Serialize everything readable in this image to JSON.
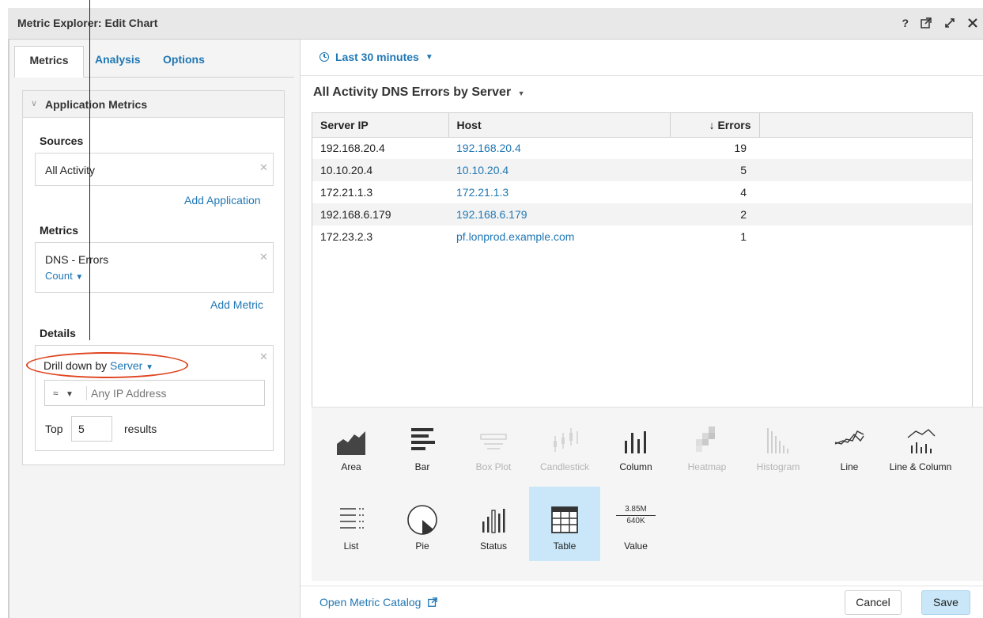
{
  "window": {
    "title": "Metric Explorer: Edit Chart",
    "help": "?",
    "icons": [
      "external-window-icon",
      "expand-icon",
      "close-icon"
    ]
  },
  "tabs": [
    {
      "label": "Metrics",
      "active": true
    },
    {
      "label": "Analysis",
      "active": false
    },
    {
      "label": "Options",
      "active": false
    }
  ],
  "panel": {
    "header": "Application Metrics",
    "sources": {
      "title": "Sources",
      "value": "All Activity",
      "add_link": "Add Application"
    },
    "metrics": {
      "title": "Metrics",
      "value": "DNS - Errors",
      "aggregate": "Count",
      "add_link": "Add Metric"
    },
    "details": {
      "title": "Details",
      "drill_prefix": "Drill down by",
      "drill_value": "Server",
      "operator": "≈",
      "filter_placeholder": "Any IP Address",
      "top_label": "Top",
      "top_value": "5",
      "results_label": "results"
    }
  },
  "time_range": "Last 30 minutes",
  "chart_title": "All Activity DNS Errors by Server",
  "table": {
    "columns": [
      "Server IP",
      "Host",
      "↓ Errors"
    ],
    "rows": [
      {
        "server_ip": "192.168.20.4",
        "host": "192.168.20.4",
        "errors": "19"
      },
      {
        "server_ip": "10.10.20.4",
        "host": "10.10.20.4",
        "errors": "5"
      },
      {
        "server_ip": "172.21.1.3",
        "host": "172.21.1.3",
        "errors": "4"
      },
      {
        "server_ip": "192.168.6.179",
        "host": "192.168.6.179",
        "errors": "2"
      },
      {
        "server_ip": "172.23.2.3",
        "host": "pf.lonprod.example.com",
        "errors": "1"
      }
    ]
  },
  "chart_types": [
    {
      "label": "Area",
      "icon": "area-chart-icon",
      "enabled": true
    },
    {
      "label": "Bar",
      "icon": "bar-chart-icon",
      "enabled": true
    },
    {
      "label": "Box Plot",
      "icon": "box-plot-icon",
      "enabled": false
    },
    {
      "label": "Candlestick",
      "icon": "candlestick-icon",
      "enabled": false
    },
    {
      "label": "Column",
      "icon": "column-chart-icon",
      "enabled": true
    },
    {
      "label": "Heatmap",
      "icon": "heatmap-icon",
      "enabled": false
    },
    {
      "label": "Histogram",
      "icon": "histogram-icon",
      "enabled": false
    },
    {
      "label": "Line",
      "icon": "line-chart-icon",
      "enabled": true
    },
    {
      "label": "Line & Column",
      "icon": "line-column-icon",
      "enabled": true
    },
    {
      "label": "List",
      "icon": "list-icon",
      "enabled": true
    },
    {
      "label": "Pie",
      "icon": "pie-chart-icon",
      "enabled": true
    },
    {
      "label": "Status",
      "icon": "status-icon",
      "enabled": true
    },
    {
      "label": "Table",
      "icon": "table-icon",
      "enabled": true,
      "selected": true
    },
    {
      "label": "Value",
      "icon": "value-icon",
      "enabled": true,
      "value_top": "3.85M",
      "value_bottom": "640K"
    }
  ],
  "footer": {
    "catalog_link": "Open Metric Catalog",
    "cancel": "Cancel",
    "save": "Save"
  },
  "colors": {
    "accent": "#1f77b4",
    "selected_bg": "#c9e7f8",
    "annotation": "#e0441f"
  }
}
